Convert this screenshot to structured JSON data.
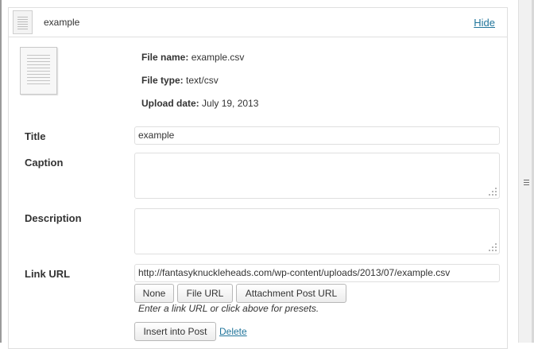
{
  "item": {
    "title": "example",
    "hide_label": "Hide"
  },
  "file_info": {
    "name_label": "File name:",
    "name_value": "example.csv",
    "type_label": "File type:",
    "type_value": "text/csv",
    "date_label": "Upload date:",
    "date_value": "July 19, 2013"
  },
  "form": {
    "title_label": "Title",
    "title_value": "example",
    "caption_label": "Caption",
    "caption_value": "",
    "description_label": "Description",
    "description_value": "",
    "link_url_label": "Link URL",
    "link_url_value": "http://fantasyknuckleheads.com/wp-content/uploads/2013/07/example.csv"
  },
  "link_buttons": {
    "none": "None",
    "file_url": "File URL",
    "attachment_post_url": "Attachment Post URL"
  },
  "hint": "Enter a link URL or click above for presets.",
  "actions": {
    "insert_label": "Insert into Post",
    "delete_label": "Delete"
  },
  "icons": {
    "thumbnail": "document-icon",
    "resize": "resize-grip-icon"
  },
  "colors": {
    "link": "#21759b",
    "border": "#dfdfdf"
  }
}
